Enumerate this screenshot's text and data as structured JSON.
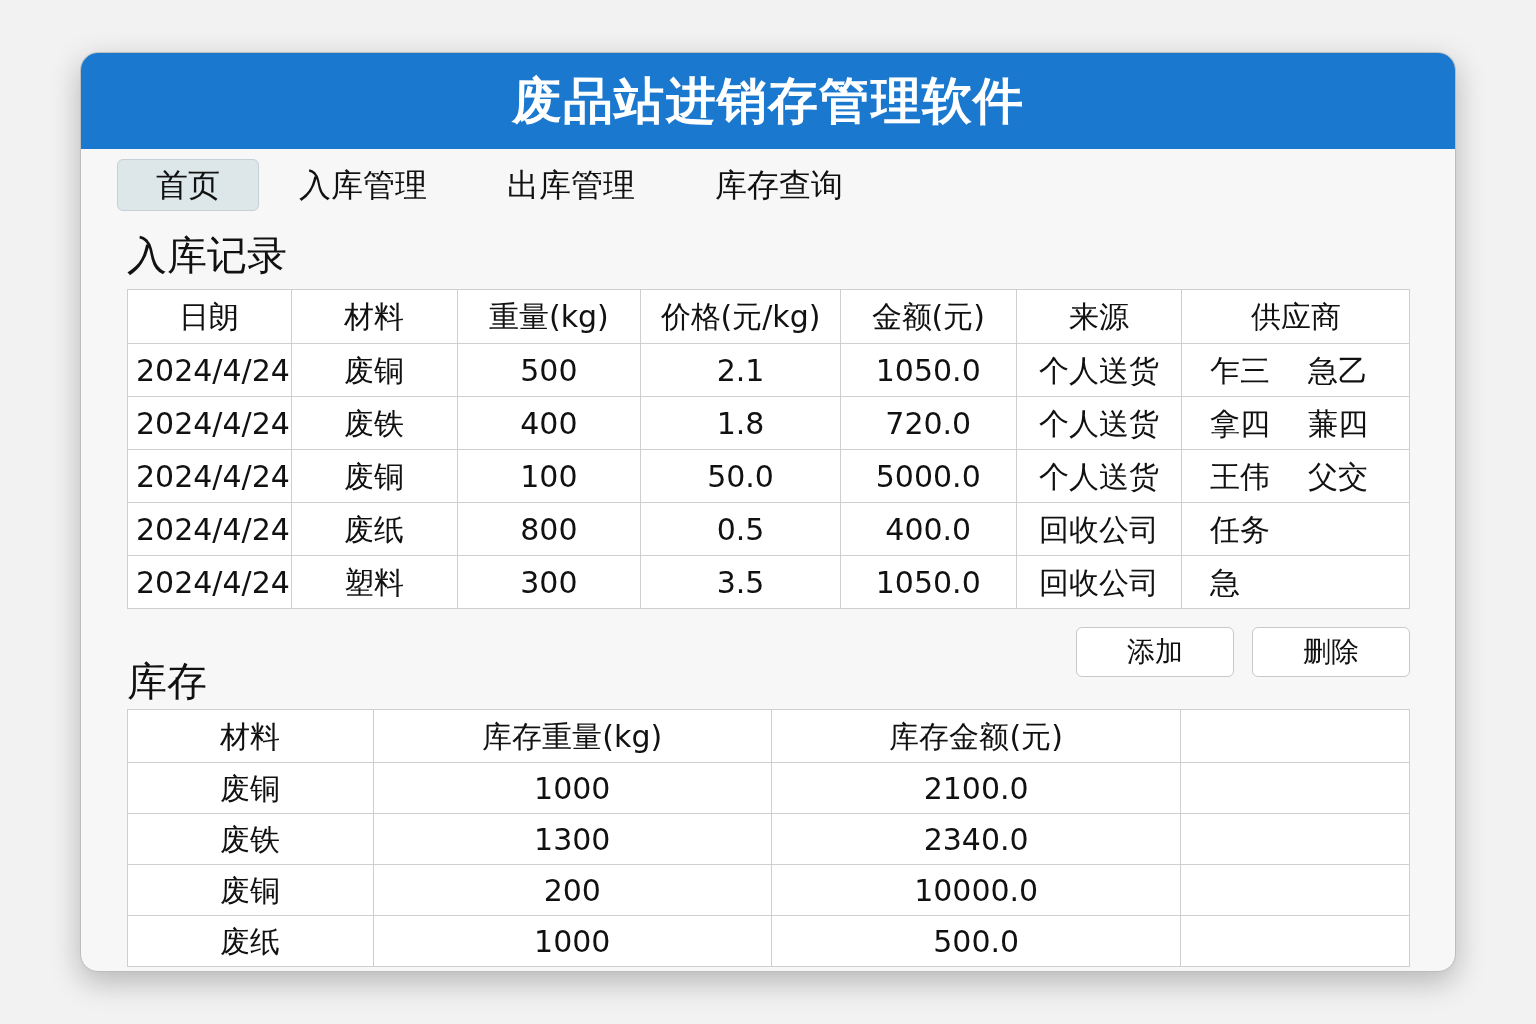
{
  "window": {
    "title": "废品站进销存管理软件"
  },
  "tabs": [
    {
      "label": "首页",
      "selected": true
    },
    {
      "label": "入库管理",
      "selected": false
    },
    {
      "label": "出库管理",
      "selected": false
    },
    {
      "label": "库存查询",
      "selected": false
    }
  ],
  "inbound": {
    "title": "入库记录",
    "columns": [
      "日朗",
      "材料",
      "重量(kg)",
      "价格(元/kg)",
      "金额(元)",
      "来源",
      "供应商"
    ],
    "rows": [
      {
        "date": "2024/4/24",
        "material": "废铜",
        "weight": "500",
        "price": "2.1",
        "amount": "1050.0",
        "source": "个人送货",
        "suppliers": [
          "乍三",
          "急乙"
        ]
      },
      {
        "date": "2024/4/24",
        "material": "废铁",
        "weight": "400",
        "price": "1.8",
        "amount": "720.0",
        "source": "个人送货",
        "suppliers": [
          "拿四",
          "蒹四"
        ]
      },
      {
        "date": "2024/4/24",
        "material": "废铜",
        "weight": "100",
        "price": "50.0",
        "amount": "5000.0",
        "source": "个人送货",
        "suppliers": [
          "王伟",
          "父交"
        ]
      },
      {
        "date": "2024/4/24",
        "material": "废纸",
        "weight": "800",
        "price": "0.5",
        "amount": "400.0",
        "source": "回收公司",
        "suppliers": [
          "任务"
        ]
      },
      {
        "date": "2024/4/24",
        "material": "塑料",
        "weight": "300",
        "price": "3.5",
        "amount": "1050.0",
        "source": "回收公司",
        "suppliers": [
          "急"
        ]
      }
    ]
  },
  "buttons": [
    "添加",
    "删除"
  ],
  "stock": {
    "title": "库存",
    "columns": [
      "材料",
      "库存重量(kg)",
      "库存金额(元)"
    ],
    "rows": [
      {
        "material": "废铜",
        "weight": "1000",
        "amount": "2100.0"
      },
      {
        "material": "废铁",
        "weight": "1300",
        "amount": "2340.0"
      },
      {
        "material": "废铜",
        "weight": "200",
        "amount": "10000.0"
      },
      {
        "material": "废纸",
        "weight": "1000",
        "amount": "500.0"
      }
    ]
  }
}
